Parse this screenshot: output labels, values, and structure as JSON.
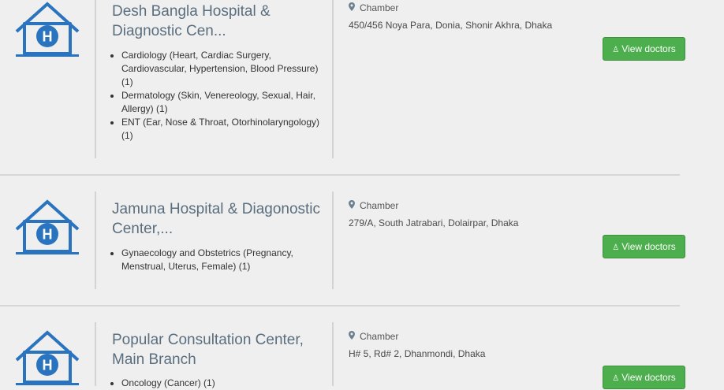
{
  "chamber_label": "Chamber",
  "view_button_label": "View doctors",
  "hospitals": [
    {
      "name": "Desh Bangla Hospital & Diagnostic Cen...",
      "specialities": [
        "Cardiology (Heart, Cardiac Surgery, Cardiovascular, Hypertension, Blood Pressure) (1)",
        "Dermatology (Skin, Venereology, Sexual, Hair, Allergy) (1)",
        "ENT (Ear, Nose & Throat, Otorhinolaryngology) (1)"
      ],
      "address": "450/456 Noya Para, Donia, Shonir Akhra, Dhaka"
    },
    {
      "name": "Jamuna Hospital & Diagonostic Center,...",
      "specialities": [
        "Gynaecology and Obstetrics (Pregnancy, Menstrual, Uterus, Female) (1)"
      ],
      "address": "279/A, South Jatrabari, Dolairpar, Dhaka"
    },
    {
      "name": "Popular Consultation Center, Main Branch",
      "specialities": [
        "Oncology (Cancer) (1)"
      ],
      "address": "H# 5, Rd# 2, Dhanmondi, Dhaka"
    }
  ]
}
